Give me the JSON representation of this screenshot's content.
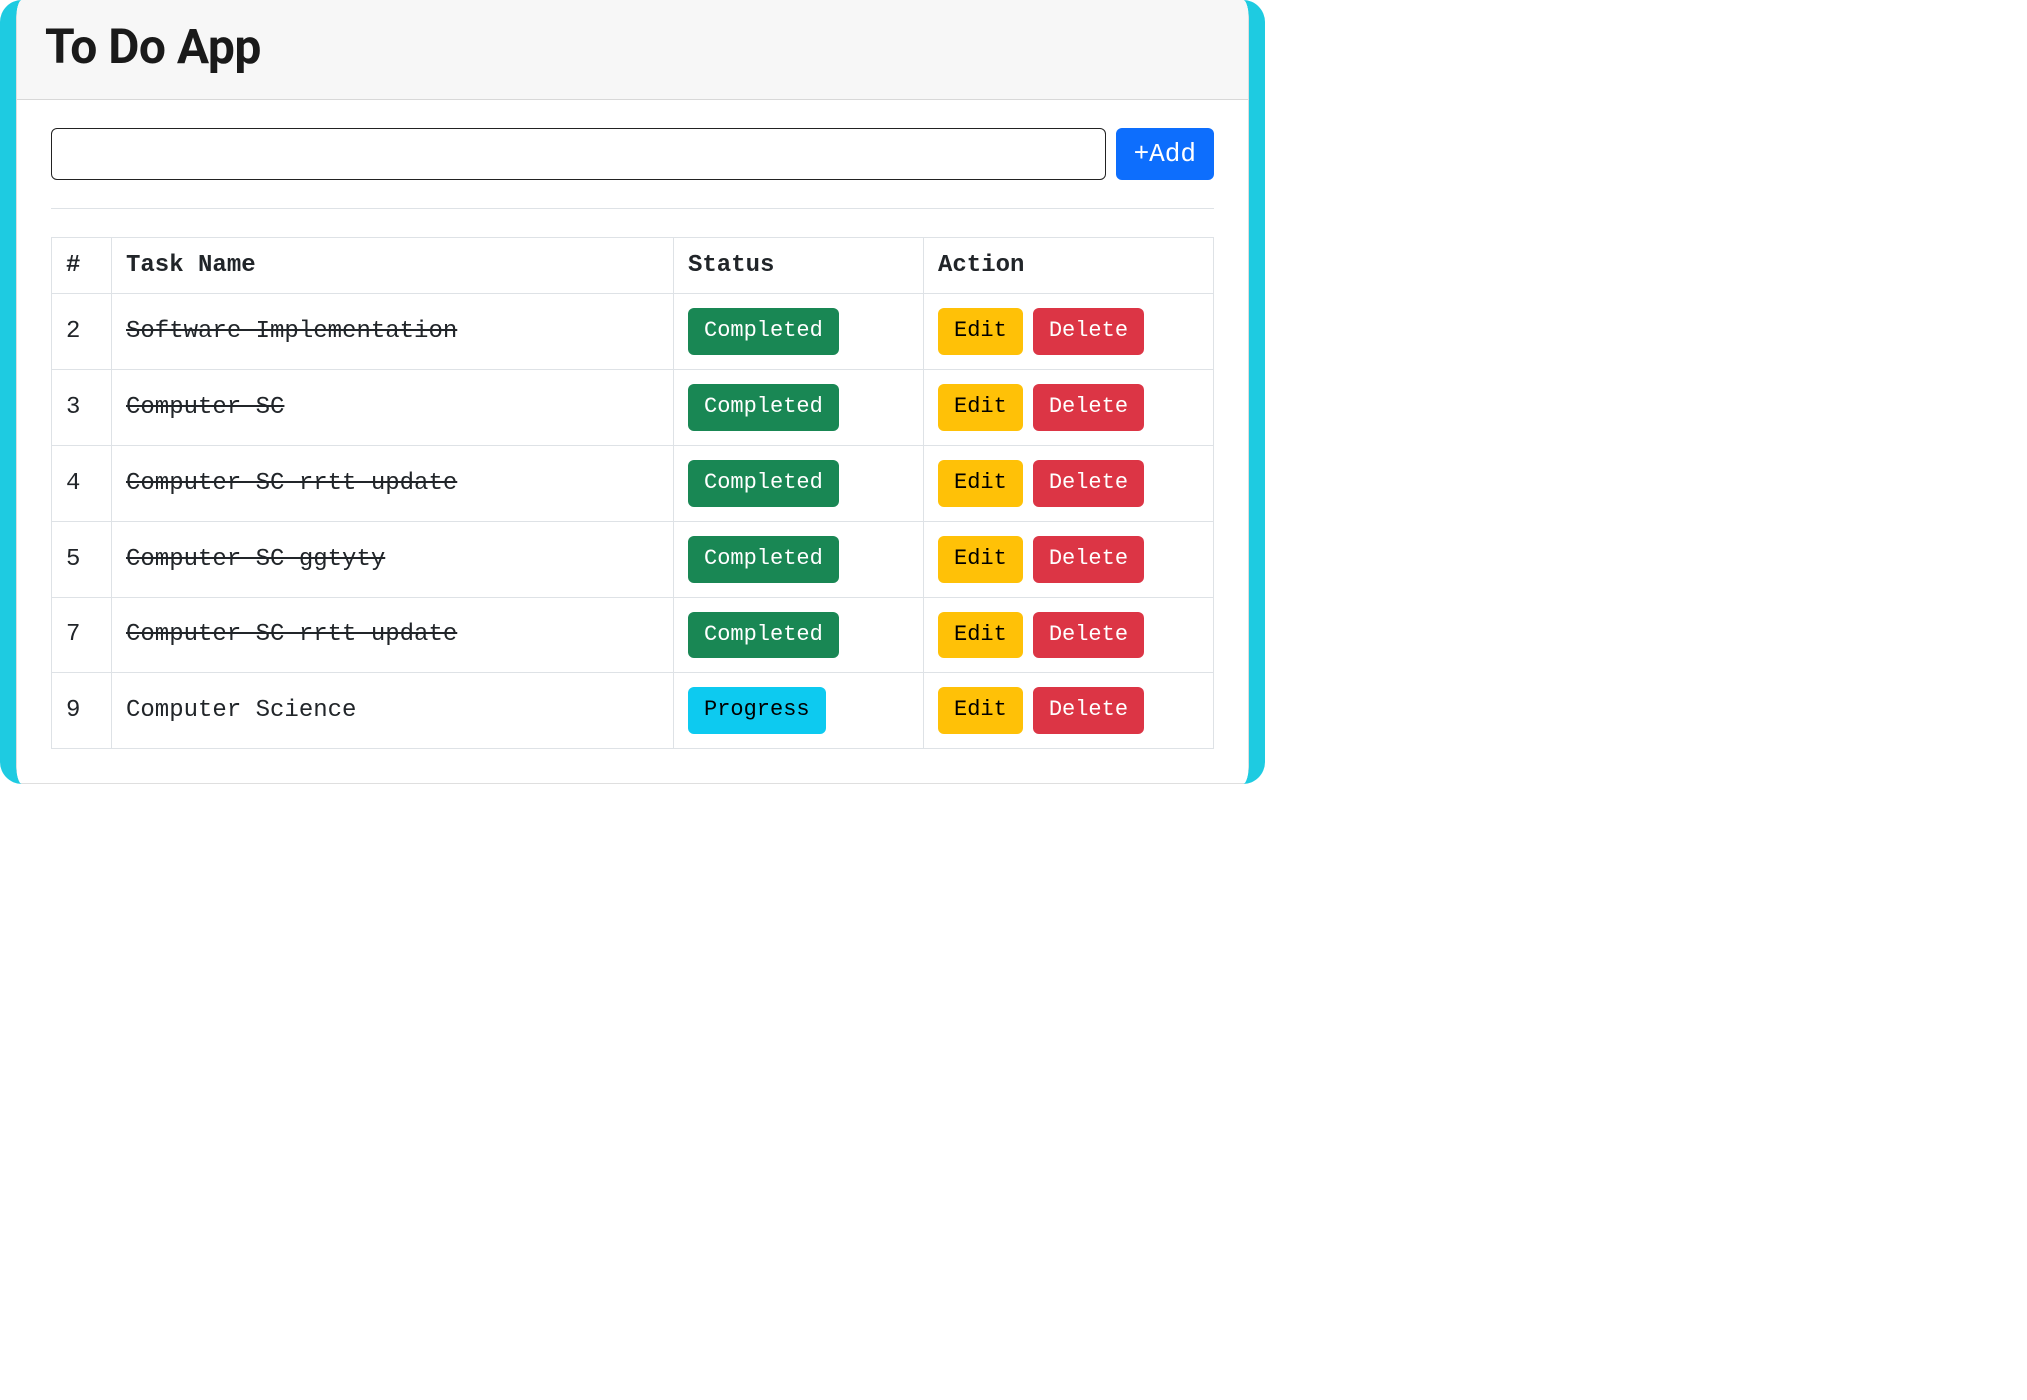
{
  "header": {
    "title": "To Do App"
  },
  "form": {
    "input_value": "",
    "add_button_label": "+Add"
  },
  "table": {
    "columns": {
      "num": "#",
      "task": "Task Name",
      "status": "Status",
      "action": "Action"
    },
    "status_labels": {
      "completed": "Completed",
      "progress": "Progress"
    },
    "action_labels": {
      "edit": "Edit",
      "delete": "Delete"
    },
    "rows": [
      {
        "num": "2",
        "task": "Software Implementation",
        "status": "completed"
      },
      {
        "num": "3",
        "task": "Computer SC",
        "status": "completed"
      },
      {
        "num": "4",
        "task": "Computer SC rrtt update",
        "status": "completed"
      },
      {
        "num": "5",
        "task": "Computer SC ggtyty",
        "status": "completed"
      },
      {
        "num": "7",
        "task": "Computer SC rrtt update",
        "status": "completed"
      },
      {
        "num": "9",
        "task": "Computer Science",
        "status": "progress"
      }
    ]
  }
}
